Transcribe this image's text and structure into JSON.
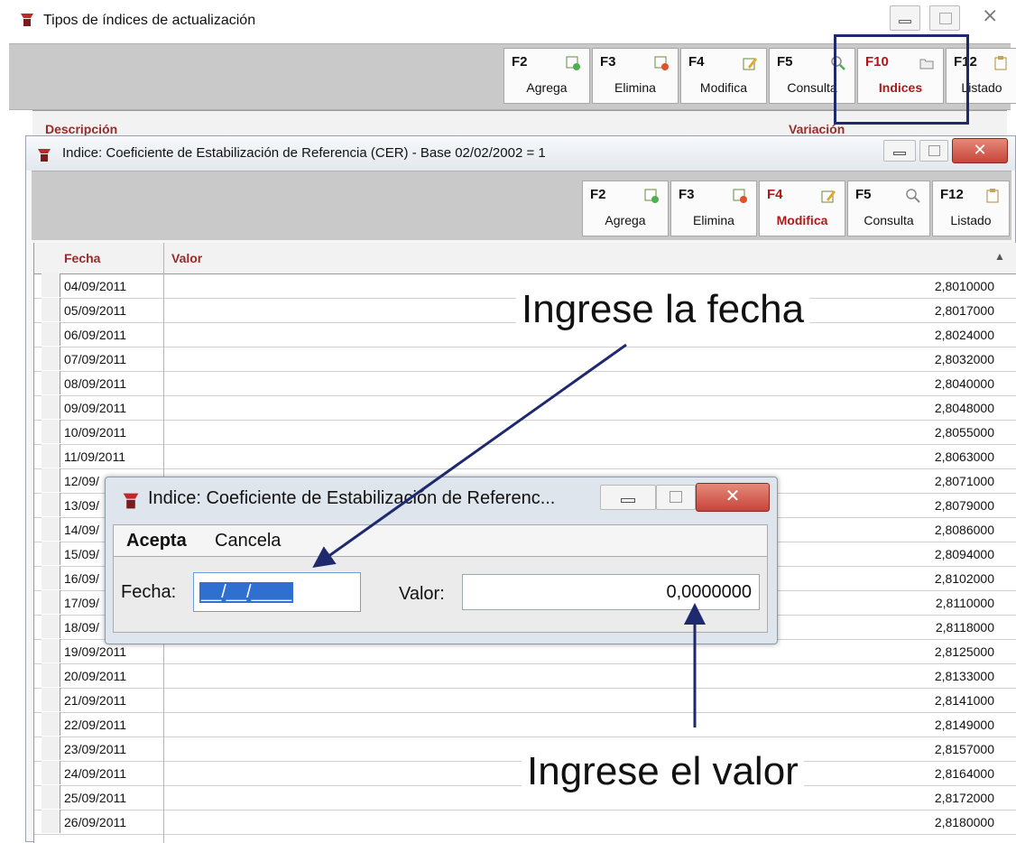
{
  "outer_window": {
    "title": "Tipos de índices de actualización",
    "toolbar": [
      {
        "key": "F2",
        "label": "Agrega"
      },
      {
        "key": "F3",
        "label": "Elimina"
      },
      {
        "key": "F4",
        "label": "Modifica"
      },
      {
        "key": "F5",
        "label": "Consulta"
      },
      {
        "key": "F10",
        "label": "Indices"
      },
      {
        "key": "F12",
        "label": "Listado"
      }
    ],
    "columns": {
      "descripcion": "Descripción",
      "variacion": "Variación"
    }
  },
  "inner_window": {
    "title": "Indice: Coeficiente de Estabilización de Referencia (CER) - Base 02/02/2002 = 1",
    "toolbar": [
      {
        "key": "F2",
        "label": "Agrega"
      },
      {
        "key": "F3",
        "label": "Elimina"
      },
      {
        "key": "F4",
        "label": "Modifica"
      },
      {
        "key": "F5",
        "label": "Consulta"
      },
      {
        "key": "F12",
        "label": "Listado"
      }
    ],
    "columns": {
      "fecha": "Fecha",
      "valor": "Valor"
    },
    "rows": [
      {
        "fecha": "04/09/2011",
        "valor": "2,8010000"
      },
      {
        "fecha": "05/09/2011",
        "valor": "2,8017000"
      },
      {
        "fecha": "06/09/2011",
        "valor": "2,8024000"
      },
      {
        "fecha": "07/09/2011",
        "valor": "2,8032000"
      },
      {
        "fecha": "08/09/2011",
        "valor": "2,8040000"
      },
      {
        "fecha": "09/09/2011",
        "valor": "2,8048000"
      },
      {
        "fecha": "10/09/2011",
        "valor": "2,8055000"
      },
      {
        "fecha": "11/09/2011",
        "valor": "2,8063000"
      },
      {
        "fecha": "12/09/",
        "valor": "2,8071000"
      },
      {
        "fecha": "13/09/",
        "valor": "2,8079000"
      },
      {
        "fecha": "14/09/",
        "valor": "2,8086000"
      },
      {
        "fecha": "15/09/",
        "valor": "2,8094000"
      },
      {
        "fecha": "16/09/",
        "valor": "2,8102000"
      },
      {
        "fecha": "17/09/",
        "valor": "2,8110000"
      },
      {
        "fecha": "18/09/",
        "valor": "2,8118000"
      },
      {
        "fecha": "19/09/2011",
        "valor": "2,8125000"
      },
      {
        "fecha": "20/09/2011",
        "valor": "2,8133000"
      },
      {
        "fecha": "21/09/2011",
        "valor": "2,8141000"
      },
      {
        "fecha": "22/09/2011",
        "valor": "2,8149000"
      },
      {
        "fecha": "23/09/2011",
        "valor": "2,8157000"
      },
      {
        "fecha": "24/09/2011",
        "valor": "2,8164000"
      },
      {
        "fecha": "25/09/2011",
        "valor": "2,8172000"
      },
      {
        "fecha": "26/09/2011",
        "valor": "2,8180000"
      }
    ]
  },
  "dialog": {
    "title": "Indice: Coeficiente de Estabilización de Referenc...",
    "menu": {
      "accept": "Acepta",
      "cancel": "Cancela"
    },
    "fecha_label": "Fecha:",
    "fecha_value": "__/__/____",
    "valor_label": "Valor:",
    "valor_value": "0,0000000"
  },
  "annotations": {
    "fecha": "Ingrese la fecha",
    "valor": "Ingrese el valor"
  },
  "colors": {
    "active_button": "#b01818",
    "header_text": "#9a2a2a",
    "highlight_box": "#1f2a6e",
    "arrow": "#1f2a6e",
    "close_button": "#c8443a"
  }
}
